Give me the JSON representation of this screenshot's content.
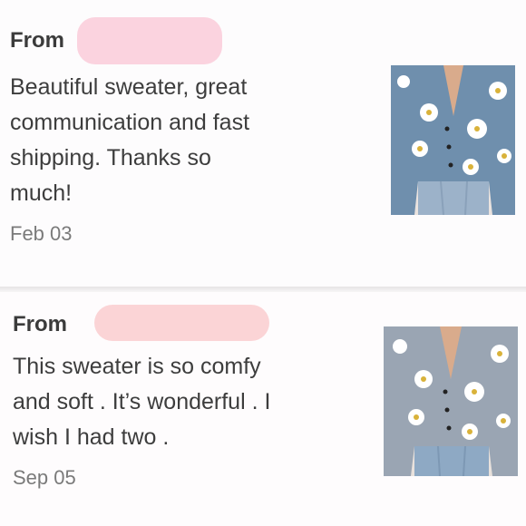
{
  "reviews": [
    {
      "from_label": "From",
      "text_lines": [
        "Beautiful sweater, great",
        "communication and fast",
        "shipping. Thanks so",
        "much!"
      ],
      "date": "Feb 03",
      "photo_icon": "sweater-photo"
    },
    {
      "from_label": "From",
      "text_lines": [
        "This sweater is so comfy",
        "and soft . It’s wonderful . I",
        "wish I had two ."
      ],
      "date": "Sep 05",
      "photo_icon": "sweater-photo"
    }
  ],
  "colors": {
    "redaction": "#fbd3dd",
    "cardigan_blue": "#6f8fad",
    "cardigan_gray": "#9aa5b3"
  }
}
